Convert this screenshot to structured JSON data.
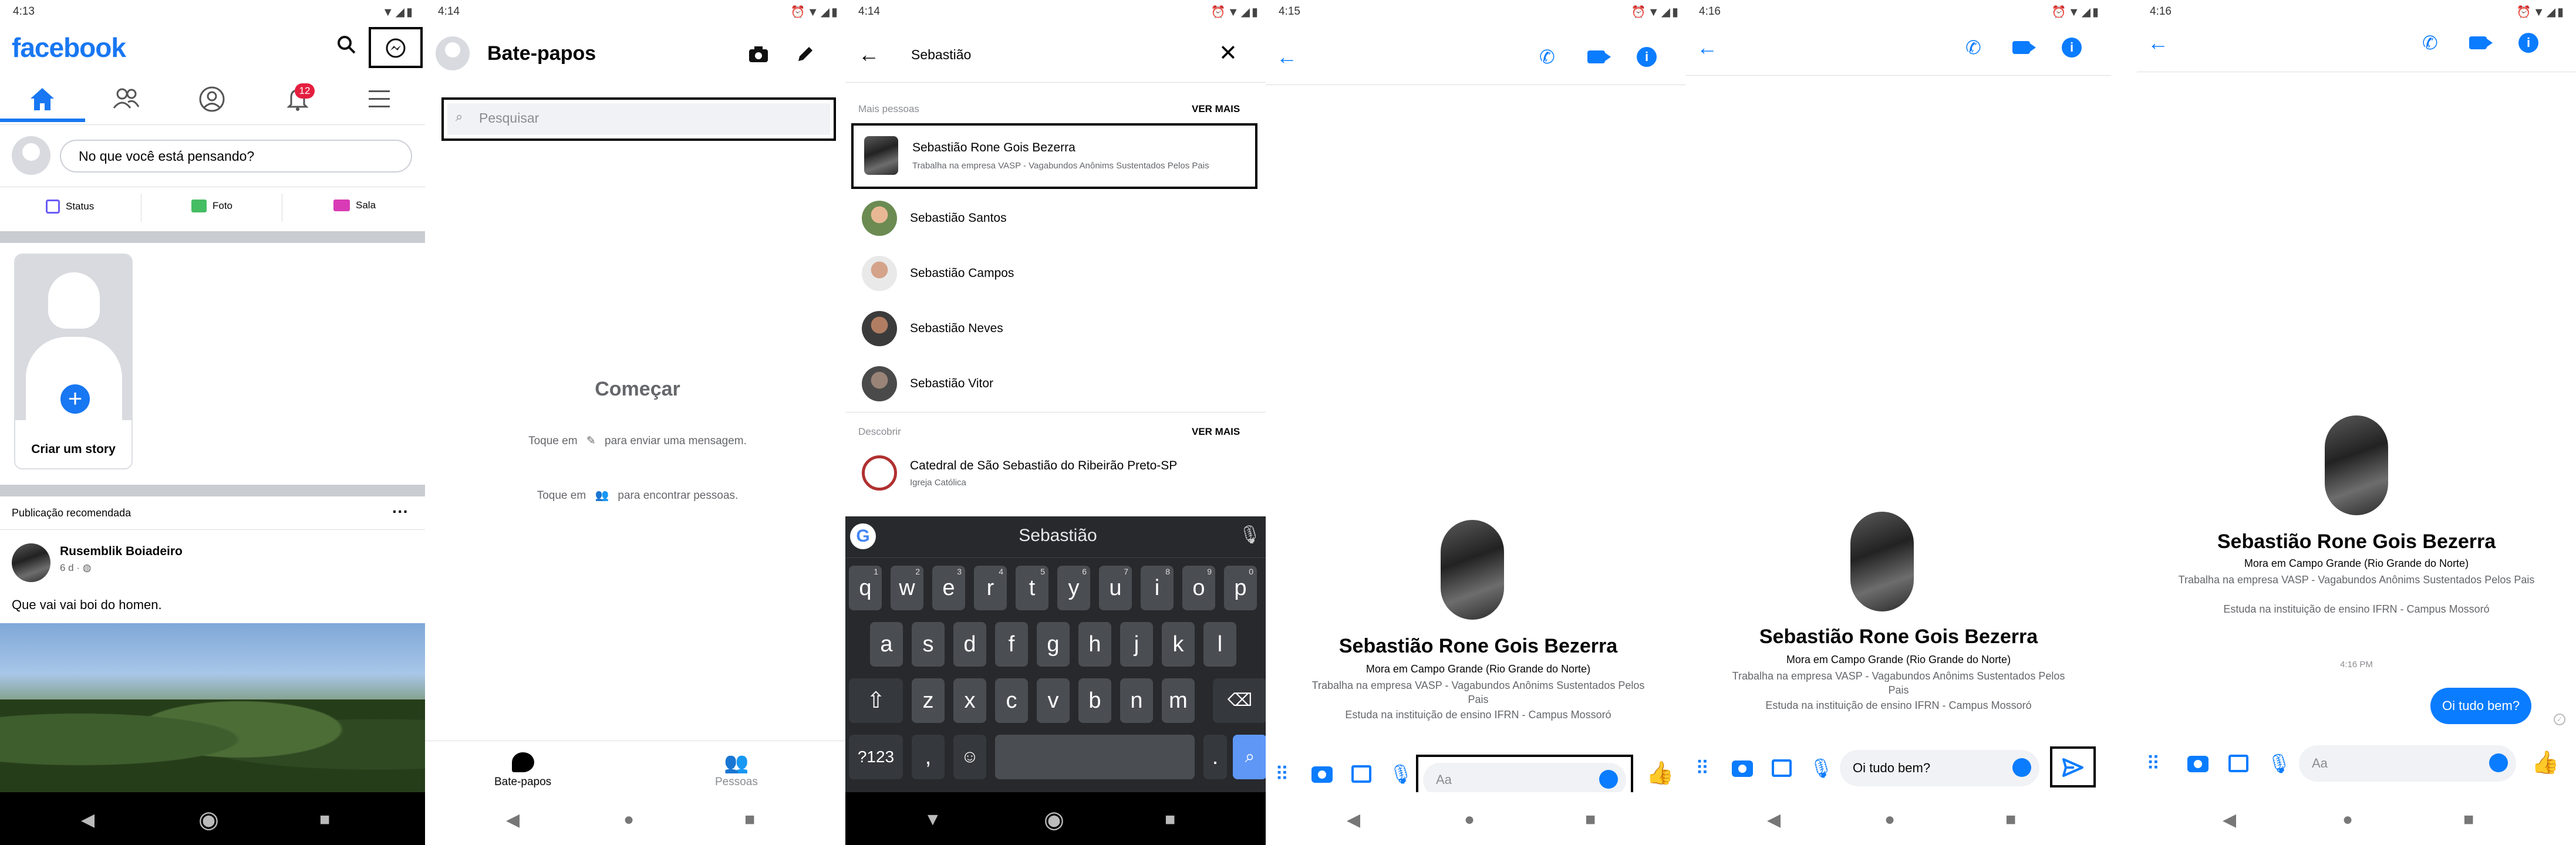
{
  "s1": {
    "time": "4:13",
    "logo": "facebook",
    "notif_count": "12",
    "composer_placeholder": "No que você está pensando?",
    "actions": [
      "Status",
      "Foto",
      "Sala"
    ],
    "story_label": "Criar um story",
    "recommended": "Publicação recomendada",
    "post_author": "Rusemblik Boiadeiro",
    "post_meta": "6 d ·",
    "post_text": "Que vai vai boi do homen."
  },
  "s2": {
    "time": "4:14",
    "title": "Bate-papos",
    "search_placeholder": "Pesquisar",
    "start_title": "Começar",
    "hint1_a": "Toque em",
    "hint1_b": "para enviar uma mensagem.",
    "hint2_a": "Toque em",
    "hint2_b": "para encontrar pessoas.",
    "tab_chats": "Bate-papos",
    "tab_people": "Pessoas"
  },
  "s3": {
    "time": "4:14",
    "query": "Sebastião",
    "section_more": "Mais pessoas",
    "see_more": "VER MAIS",
    "results": [
      {
        "name": "Sebastião Rone Gois Bezerra",
        "sub": "Trabalha na empresa VASP - Vagabundos Anônims Sustentados Pelos Pais"
      },
      {
        "name": "Sebastião Santos",
        "sub": ""
      },
      {
        "name": "Sebastião Campos",
        "sub": ""
      },
      {
        "name": "Sebastião Neves",
        "sub": ""
      },
      {
        "name": "Sebastião Vitor",
        "sub": ""
      }
    ],
    "section_discover": "Descobrir",
    "discover": {
      "name": "Catedral de São Sebastião do Ribeirão Preto-SP",
      "sub": "Igreja Católica"
    },
    "kb_suggestion": "Sebastião",
    "kb_row1": [
      "q",
      "w",
      "e",
      "r",
      "t",
      "y",
      "u",
      "i",
      "o",
      "p"
    ],
    "kb_row1_nums": [
      "1",
      "2",
      "3",
      "4",
      "5",
      "6",
      "7",
      "8",
      "9",
      "0"
    ],
    "kb_row2": [
      "a",
      "s",
      "d",
      "f",
      "g",
      "h",
      "j",
      "k",
      "l"
    ],
    "kb_row3": [
      "z",
      "x",
      "c",
      "v",
      "b",
      "n",
      "m"
    ],
    "kb_sym": "?123",
    "kb_comma": ",",
    "kb_period": "."
  },
  "profile": {
    "name": "Sebastião Rone Gois Bezerra",
    "lives": "Mora em Campo Grande (Rio Grande do Norte)",
    "work": "Trabalha na empresa VASP - Vagabundos Anônims Sustentados Pelos Pais",
    "study": "Estuda na instituição de ensino IFRN - Campus Mossoró"
  },
  "s4": {
    "time": "4:15",
    "input_placeholder": "Aa"
  },
  "s5": {
    "time": "4:16",
    "input_value": "Oi tudo bem?"
  },
  "s6": {
    "time": "4:16",
    "timestamp": "4:16 PM",
    "message": "Oi tudo bem?",
    "input_placeholder": "Aa"
  }
}
